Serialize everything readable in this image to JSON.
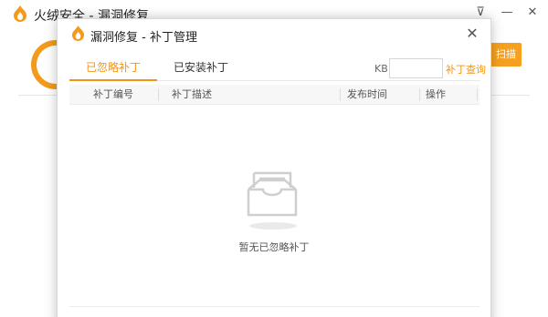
{
  "main_window": {
    "title": "火绒安全 - 漏洞修复",
    "scan_button_label": "扫描",
    "controls": {
      "menu": "⊽",
      "minimize": "—",
      "close": "✕"
    }
  },
  "dialog": {
    "title": "漏洞修复 - 补丁管理",
    "close_glyph": "✕",
    "tabs": [
      {
        "label": "已忽略补丁",
        "active": true
      },
      {
        "label": "已安装补丁",
        "active": false
      }
    ],
    "search": {
      "label": "KB",
      "value": "",
      "placeholder": "",
      "query_link": "补丁查询"
    },
    "table": {
      "columns": [
        "补丁编号",
        "补丁描述",
        "发布时间",
        "操作"
      ],
      "rows": []
    },
    "empty_state": {
      "icon": "empty-inbox-icon",
      "text": "暂无已忽略补丁"
    }
  },
  "colors": {
    "accent": "#f29418",
    "scan_button": "#f5a11f"
  }
}
